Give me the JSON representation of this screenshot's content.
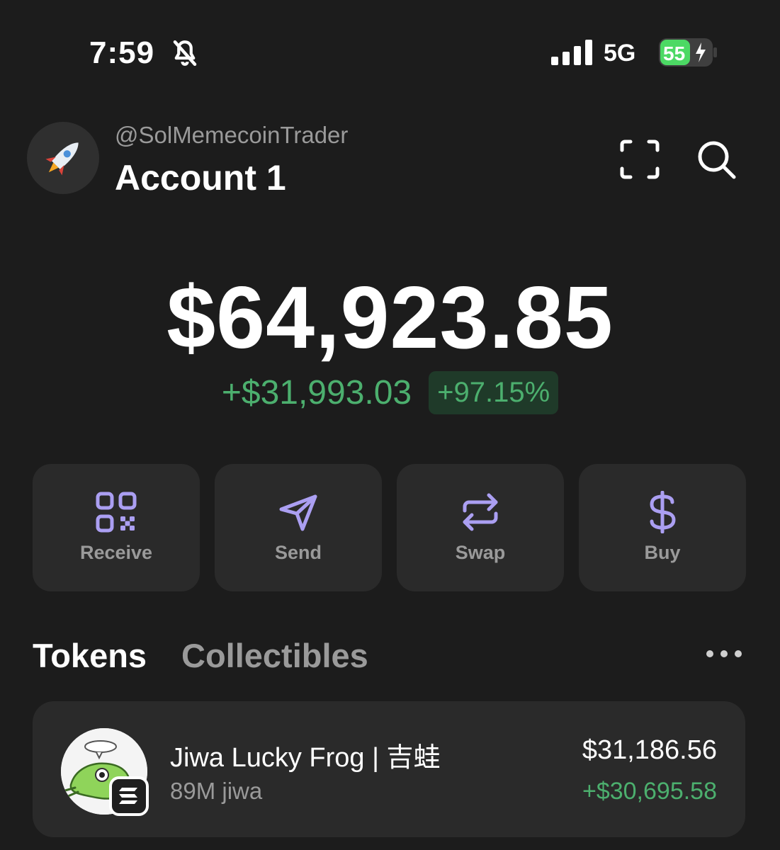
{
  "status_bar": {
    "time": "7:59",
    "network": "5G",
    "battery_level": "55",
    "icons": [
      "bell-slash-icon",
      "signal-icon",
      "battery-charging-icon"
    ]
  },
  "header": {
    "handle": "@SolMemecoinTrader",
    "account_name": "Account 1",
    "avatar_icon": "rocket-icon",
    "actions": [
      "scan-icon",
      "search-icon"
    ]
  },
  "balance": {
    "total": "$64,923.85",
    "change_amount": "+$31,993.03",
    "change_percent": "+97.15%"
  },
  "actions": [
    {
      "label": "Receive",
      "icon": "qr-code-icon"
    },
    {
      "label": "Send",
      "icon": "send-icon"
    },
    {
      "label": "Swap",
      "icon": "swap-icon"
    },
    {
      "label": "Buy",
      "icon": "dollar-icon"
    }
  ],
  "tabs": {
    "tokens": "Tokens",
    "collectibles": "Collectibles",
    "active": "Tokens"
  },
  "tokens": [
    {
      "name": "Jiwa Lucky Frog | 吉蛙",
      "quantity": "89M jiwa",
      "value": "$31,186.56",
      "change": "+$30,695.58",
      "icon": "frog-token-icon",
      "chain_badge": "solana-icon"
    }
  ],
  "colors": {
    "background": "#1c1c1c",
    "card": "#2a2a2a",
    "accent_purple": "#ab9ff2",
    "positive_green": "#4caf6e",
    "muted_text": "#9a9a9a"
  }
}
